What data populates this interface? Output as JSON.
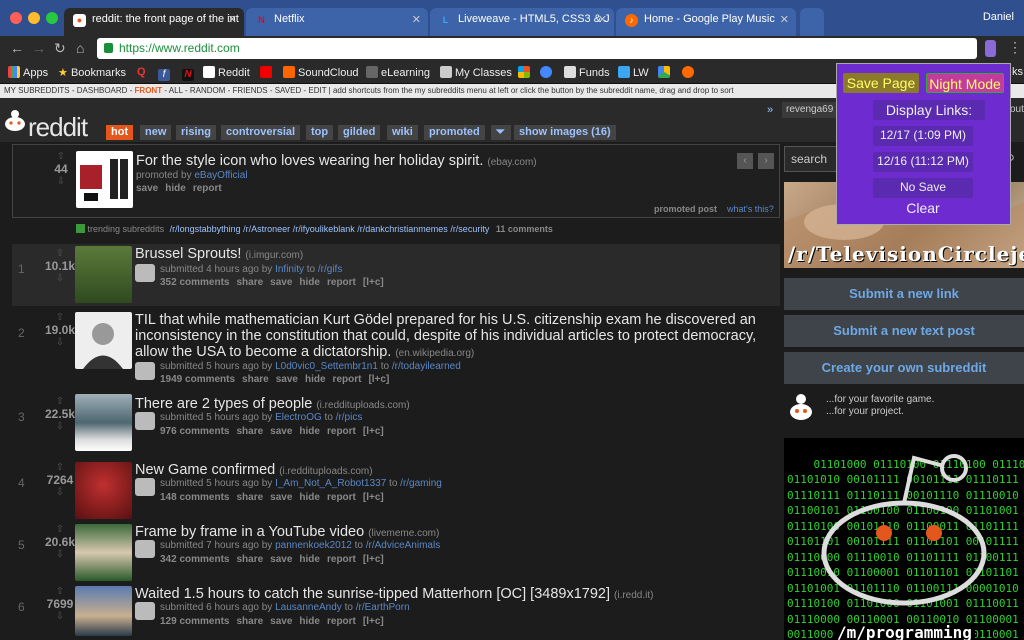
{
  "browser": {
    "tabs": [
      {
        "title": "reddit: the front page of the int",
        "active": true
      },
      {
        "title": "Netflix",
        "active": false
      },
      {
        "title": "Liveweave - HTML5, CSS3 & J",
        "active": false
      },
      {
        "title": "Home - Google Play Music",
        "active": false
      }
    ],
    "profile": "Daniel",
    "url": "https://www.reddit.com",
    "bookmarks": [
      "Apps",
      "Bookmarks",
      "Q",
      "f",
      "",
      "Reddit",
      "",
      "SoundCloud",
      "eLearning",
      "My Classes",
      "",
      "",
      "Funds",
      "LW",
      ""
    ],
    "bookmarks_overflow": "ks"
  },
  "srbar": {
    "prefix": "MY SUBREDDITS - DASHBOARD -",
    "front": "FRONT",
    "rest": "- ALL - RANDOM - FRIENDS - SAVED - EDIT  |  add shortcuts from the my subreddits menu at left or click the button by the subreddit name, drag and drop to sort"
  },
  "header": {
    "logo": "reddit",
    "tabs": [
      "hot",
      "new",
      "rising",
      "controversial",
      "top",
      "gilded",
      "wiki",
      "promoted",
      "show images (16)"
    ],
    "user": "revenga69",
    "user_overflow": "out"
  },
  "promoted": {
    "score": "44",
    "title": "For the style icon who loves wearing her holiday spirit.",
    "domain": "(ebay.com)",
    "by_prefix": "promoted by",
    "by": "eBayOfficial",
    "actions": [
      "save",
      "hide",
      "report"
    ],
    "label": "promoted post",
    "whats_this": "what's this?"
  },
  "trending": {
    "label": "trending subreddits",
    "subs": [
      "/r/longstabbything",
      "/r/Astroneer",
      "/r/ifyoulikeblank",
      "/r/dankchristianmemes",
      "/r/security"
    ],
    "comments": "11 comments"
  },
  "posts": [
    {
      "rank": "1",
      "score": "10.1k",
      "title": "Brussel Sprouts!",
      "domain": "(i.imgur.com)",
      "time": "submitted 4 hours ago by",
      "user": "Infinity",
      "sub": "/r/gifs",
      "comments": "352 comments"
    },
    {
      "rank": "2",
      "score": "19.0k",
      "title": "TIL that while mathematician Kurt Gödel prepared for his U.S. citizenship exam he discovered an inconsistency in the constitution that could, despite of his individual articles to protect democracy, allow the USA to become a dictatorship.",
      "domain": "(en.wikipedia.org)",
      "time": "submitted 5 hours ago by",
      "user": "L0d0vic0_Settembr1n1",
      "sub": "/r/todayilearned",
      "comments": "1949 comments"
    },
    {
      "rank": "3",
      "score": "22.5k",
      "title": "There are 2 types of people",
      "domain": "(i.reddituploads.com)",
      "time": "submitted 5 hours ago by",
      "user": "ElectroOG",
      "sub": "/r/pics",
      "comments": "976 comments"
    },
    {
      "rank": "4",
      "score": "7264",
      "title": "New Game confirmed",
      "domain": "(i.reddituploads.com)",
      "time": "submitted 5 hours ago by",
      "user": "I_Am_Not_A_Robot1337",
      "sub": "/r/gaming",
      "comments": "148 comments"
    },
    {
      "rank": "5",
      "score": "20.6k",
      "title": "Frame by frame in a YouTube video",
      "domain": "(livememe.com)",
      "time": "submitted 7 hours ago by",
      "user": "pannenkoek2012",
      "sub": "/r/AdviceAnimals",
      "comments": "342 comments"
    },
    {
      "rank": "6",
      "score": "7699",
      "title": "Waited 1.5 hours to catch the sunrise-tipped Matterhorn [OC] [3489x1792]",
      "domain": "(i.redd.it)",
      "time": "submitted 6 hours ago by",
      "user": "LausanneAndy",
      "sub": "/r/EarthPorn",
      "comments": "129 comments"
    }
  ],
  "post_actions": [
    "share",
    "save",
    "hide",
    "report",
    "[l+c]"
  ],
  "to": "to",
  "sidebar": {
    "search": "search",
    "banner": "/r/TelevisionCirclejerk",
    "submit_link": "Submit a new link",
    "submit_text": "Submit a new text post",
    "create": "Create your own subreddit",
    "create_line1": "...for your favorite game.",
    "create_line2": "...for your project.",
    "binary": "01101000 01110100 01110100 01110000\n01101010 00101111 00101111 01110111\n01110111 01110111 00101110 01110010\n01100101 01100100 01100100 01101001\n01110100 00101110 01100011 01101111\n01101101 00101111 01101101 00101111\n01110000 01110010 01101111 01100111\n01110010 01100001 01101101 01101101\n01101001 01101110 01100111 00001010\n01110100 01101000 01101001 01110011\n01110000 00110001 00110010 01100001\n00110000 01110011 01110100 00110001",
    "prog_caption": "/m/programming"
  },
  "popup": {
    "save_page": "Save Page",
    "night_mode": "Night Mode",
    "display_links": "Display Links:",
    "link1": "12/17 (1:09 PM)",
    "link2": "12/16 (11:12 PM)",
    "no_save": "No Save",
    "clear": "Clear"
  },
  "colors": {
    "accent": "#e3571c",
    "link": "#5a88c7",
    "popup": "#6d2bd0",
    "tab_bar": "#2f4f8f"
  }
}
